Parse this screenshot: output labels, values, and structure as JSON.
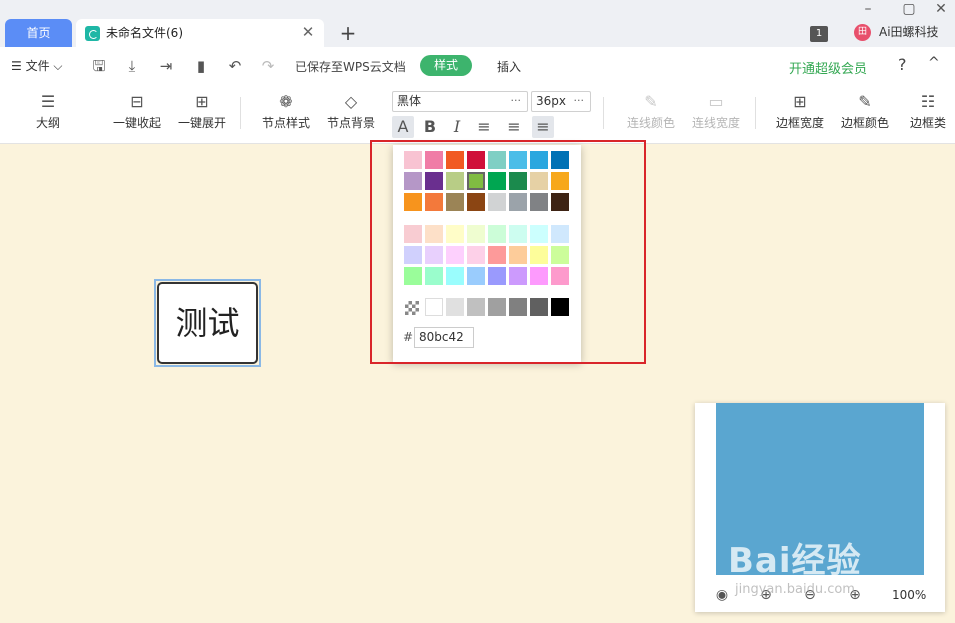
{
  "tabs": {
    "home": "首页",
    "doc_title": "未命名文件(6)"
  },
  "window": {
    "badge": "1",
    "user_initial": "田",
    "user_name": "Ai田螺科技"
  },
  "menubar": {
    "file": "☰ 文件 ⌵",
    "saved": "已保存至WPS云文档",
    "style": "样式",
    "insert": "插入",
    "vip": "开通超级会员",
    "help": "?",
    "collapse": "^"
  },
  "toolbar": {
    "outline": "大纲",
    "collapse_all": "一键收起",
    "expand_all": "一键展开",
    "node_style": "节点样式",
    "node_bg": "节点背景",
    "font": "黑体",
    "size": "36px",
    "line_color": "连线颜色",
    "line_width": "连线宽度",
    "border_width": "边框宽度",
    "border_color": "边框颜色",
    "border_type": "边框类"
  },
  "node": {
    "text": "测试"
  },
  "picker": {
    "hex_label": "#",
    "hex_value": "80bc42",
    "selected": "#80bc42",
    "rows": [
      [
        "#f8c3d2",
        "#f07ca6",
        "#f15a22",
        "#d0103a",
        "#7fcfc4",
        "#4bbde8",
        "#2ba7df",
        "#0072b5"
      ],
      [
        "#b597c7",
        "#6a2f8f",
        "#b8cd86",
        "#80bc42",
        "#00a651",
        "#1b8a4d",
        "#e6d1a5",
        "#f7a81b"
      ],
      [
        "#f7941d",
        "#f3793b",
        "#9b8456",
        "#8b4513",
        "#d1d3d4",
        "#9ba3aa",
        "#808285",
        "#3d2314"
      ],
      [
        "#f8ccd2",
        "#fde0c8",
        "#fffdc8",
        "#effdd0",
        "#ccfdd8",
        "#cdfdf0",
        "#ccfffe",
        "#d0e8fd"
      ],
      [
        "#d0d0fd",
        "#e8d0fd",
        "#fdd0fd",
        "#fdd0e8",
        "#fd9a9a",
        "#fdcc9a",
        "#fdfd9a",
        "#ccfd9a"
      ],
      [
        "#9afd9a",
        "#9afdcc",
        "#9afdfd",
        "#9accfd",
        "#9a9afd",
        "#cc9afd",
        "#fd9afd",
        "#fd9acc"
      ]
    ],
    "grays": [
      "#ffffff",
      "#e0e0e0",
      "#c0c0c0",
      "#a0a0a0",
      "#808080",
      "#606060",
      "#000000"
    ]
  },
  "navigator": {
    "zoom": "100%"
  },
  "watermark": {
    "main": "Bai经验",
    "sub": "jingyan.baidu.com"
  }
}
